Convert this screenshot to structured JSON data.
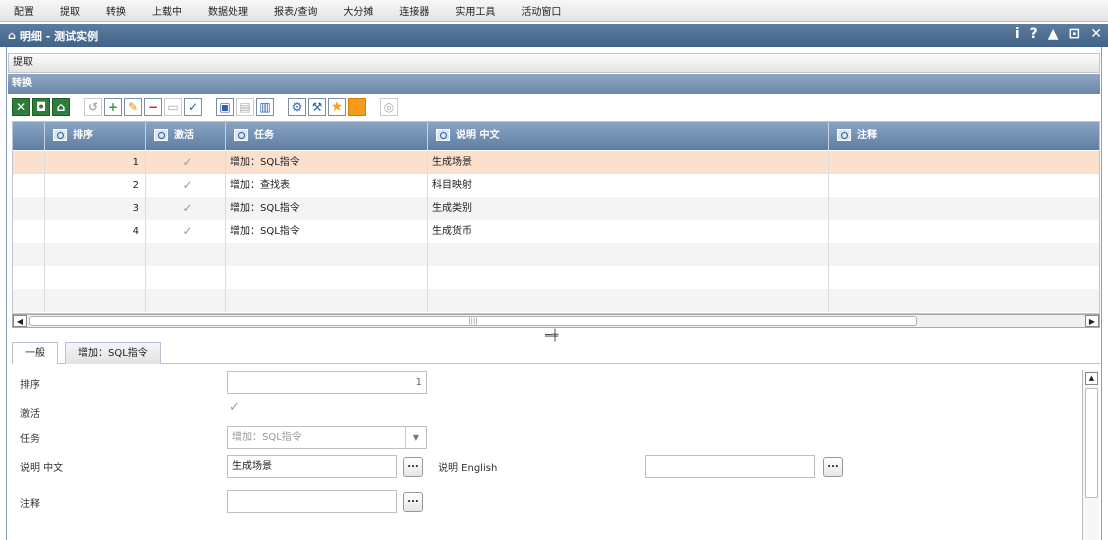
{
  "menu": [
    "配置",
    "提取",
    "转换",
    "上载中",
    "数据处理",
    "报表/查询",
    "大分摊",
    "连接器",
    "实用工具",
    "活动窗口"
  ],
  "window": {
    "title": "明细 - 测试实例",
    "controls": [
      "i",
      "?",
      "▲",
      "⊡",
      "✕"
    ]
  },
  "sections": {
    "extract": "提取",
    "transform": "转换"
  },
  "grid": {
    "headers": [
      "排序",
      "激活",
      "任务",
      "说明 中文",
      "注释"
    ],
    "rows": [
      {
        "order": "1",
        "active": "✓",
        "task": "增加：SQL指令",
        "desc": "生成场景",
        "note": ""
      },
      {
        "order": "2",
        "active": "✓",
        "task": "增加：查找表",
        "desc": "科目映射",
        "note": ""
      },
      {
        "order": "3",
        "active": "✓",
        "task": "增加：SQL指令",
        "desc": "生成类别",
        "note": ""
      },
      {
        "order": "4",
        "active": "✓",
        "task": "增加：SQL指令",
        "desc": "生成货币",
        "note": ""
      }
    ]
  },
  "tabs": [
    "一般",
    "增加：SQL指令"
  ],
  "form": {
    "order_label": "排序",
    "order_value": "1",
    "active_label": "激活",
    "active_check": "✓",
    "task_label": "任务",
    "task_value": "增加：SQL指令",
    "desc_cn_label": "说明 中文",
    "desc_cn_value": "生成场景",
    "desc_en_label": "说明 English",
    "desc_en_value": "",
    "note_label": "注释",
    "note_value": "",
    "dots": "..."
  },
  "icons": {
    "toolbar": [
      "excel-icon",
      "refresh-db-icon",
      "home-icon",
      "undo-icon",
      "add-icon",
      "edit-icon",
      "delete-icon",
      "save-icon",
      "confirm-icon",
      "copy-icon",
      "paste-icon",
      "paste-special-icon",
      "settings-icon",
      "tool-icon",
      "star-icon",
      "color-icon",
      "run-icon"
    ]
  }
}
